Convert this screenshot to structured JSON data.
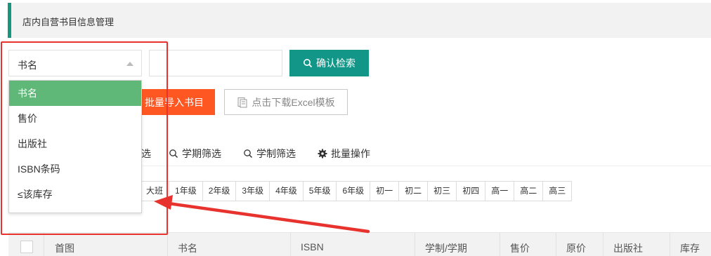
{
  "header": {
    "title": "店内自营书目信息管理"
  },
  "search": {
    "select_value": "书名",
    "input_placeholder": "",
    "search_label": "确认检索"
  },
  "actions": {
    "import_label": "批量导入书目",
    "download_label": "点击下载Excel模板"
  },
  "dropdown": {
    "options": [
      "书名",
      "售价",
      "出版社",
      "ISBN条码",
      "≤该库存"
    ],
    "selected_index": 0
  },
  "tabs": {
    "partial_label": "选",
    "term_filter": "学期筛选",
    "system_filter": "学制筛选",
    "batch_ops": "批量操作"
  },
  "grades": [
    "大班",
    "1年级",
    "2年级",
    "3年级",
    "4年级",
    "5年级",
    "6年级",
    "初一",
    "初二",
    "初三",
    "初四",
    "高一",
    "高二",
    "高三"
  ],
  "table": {
    "columns": [
      "首图",
      "书名",
      "ISBN",
      "学制/学期",
      "售价",
      "原价",
      "出版社",
      "库存"
    ]
  },
  "colors": {
    "header_accent": "#16967f",
    "search_button": "#119688",
    "import_button": "#ff5722",
    "selected_option": "#5fb878",
    "annotation": "#e8322d"
  },
  "icons": {
    "search": "magnifier-icon",
    "download": "excel-template-icon",
    "filter": "magnifier-icon",
    "batch": "gear-icon"
  }
}
